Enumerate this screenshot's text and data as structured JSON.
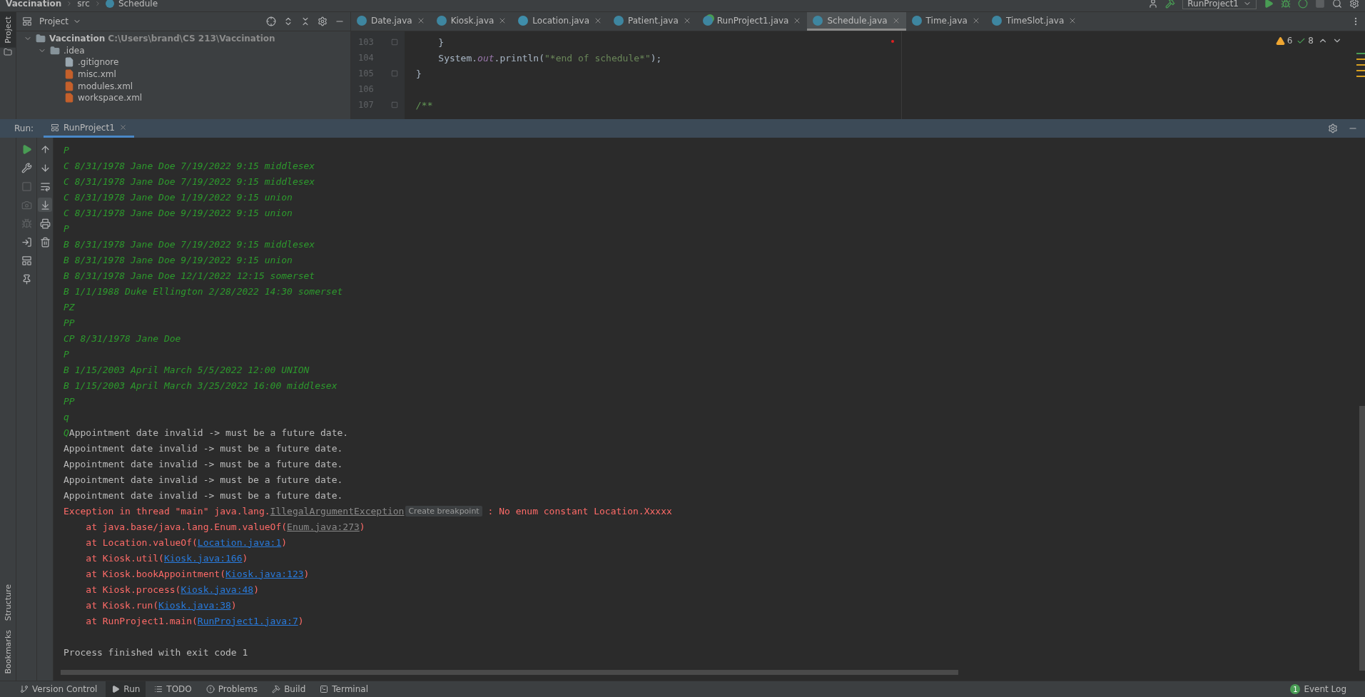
{
  "breadcrumb": [
    {
      "text": "Vaccination",
      "bold": true
    },
    {
      "text": "src",
      "bold": false
    },
    {
      "text": "Schedule",
      "bold": false
    }
  ],
  "run_config": {
    "label": "RunProject1"
  },
  "project_panel": {
    "title": "Project",
    "tree": [
      {
        "name": "Vaccination",
        "path": "C:\\Users\\brand\\CS 213\\Vaccination",
        "kind": "module",
        "expanded": true,
        "children": [
          {
            "name": ".idea",
            "kind": "folder",
            "expanded": true,
            "children": [
              {
                "name": ".gitignore",
                "kind": "ignore"
              },
              {
                "name": "misc.xml",
                "kind": "xml"
              },
              {
                "name": "modules.xml",
                "kind": "xml"
              },
              {
                "name": "workspace.xml",
                "kind": "xml"
              }
            ]
          }
        ]
      }
    ]
  },
  "editor_tabs": [
    {
      "label": "Date.java",
      "kind": "class",
      "selected": false
    },
    {
      "label": "Kiosk.java",
      "kind": "class",
      "selected": false
    },
    {
      "label": "Location.java",
      "kind": "enum",
      "selected": false
    },
    {
      "label": "Patient.java",
      "kind": "class",
      "selected": false
    },
    {
      "label": "RunProject1.java",
      "kind": "runnable",
      "selected": false
    },
    {
      "label": "Schedule.java",
      "kind": "class",
      "selected": true
    },
    {
      "label": "Time.java",
      "kind": "class",
      "selected": false
    },
    {
      "label": "TimeSlot.java",
      "kind": "class",
      "selected": false
    }
  ],
  "code_lines": [
    {
      "number": "103",
      "fold": true,
      "parts": [
        {
          "kind": "plain",
          "text": "    }"
        }
      ]
    },
    {
      "number": "104",
      "fold": false,
      "parts": [
        {
          "kind": "plain",
          "text": "    System."
        },
        {
          "kind": "field",
          "text": "out"
        },
        {
          "kind": "plain",
          "text": ".println("
        },
        {
          "kind": "string",
          "text": "\"*end of schedule*\""
        },
        {
          "kind": "plain",
          "text": ");"
        }
      ]
    },
    {
      "number": "105",
      "fold": true,
      "parts": [
        {
          "kind": "plain",
          "text": "}"
        }
      ]
    },
    {
      "number": "106",
      "fold": false
    },
    {
      "number": "107",
      "fold": true,
      "parts": [
        {
          "kind": "comment",
          "text": "/**"
        }
      ]
    }
  ],
  "inspections": {
    "warnings": "6",
    "typos": "8"
  },
  "run_panel": {
    "label": "Run:",
    "tab": "RunProject1"
  },
  "left_tools": [
    {
      "disabled": false
    },
    {
      "disabled": false
    },
    {
      "disabled": true
    },
    {
      "disabled": true
    },
    {
      "disabled": true
    },
    {
      "disabled": false
    },
    {
      "disabled": false
    },
    {
      "disabled": false
    }
  ],
  "right_tools": [
    {
      "selected": false
    },
    {
      "selected": false
    },
    {
      "selected": false
    },
    {
      "selected": true
    },
    {
      "selected": false
    },
    {
      "selected": false
    }
  ],
  "console": [
    [
      {
        "kind": "input",
        "text": "P"
      }
    ],
    [
      {
        "kind": "input",
        "text": "C 8/31/1978 Jane Doe 7/19/2022 9:15 middlesex"
      }
    ],
    [
      {
        "kind": "input",
        "text": "C 8/31/1978 Jane Doe 7/19/2022 9:15 middlesex"
      }
    ],
    [
      {
        "kind": "input",
        "text": "C 8/31/1978 Jane Doe 1/19/2022 9:15 union"
      }
    ],
    [
      {
        "kind": "input",
        "text": "C 8/31/1978 Jane Doe 9/19/2022 9:15 union"
      }
    ],
    [
      {
        "kind": "input",
        "text": "P"
      }
    ],
    [
      {
        "kind": "input",
        "text": "B 8/31/1978 Jane Doe 7/19/2022 9:15 middlesex"
      }
    ],
    [
      {
        "kind": "input",
        "text": "B 8/31/1978 Jane Doe 9/19/2022 9:15 union"
      }
    ],
    [
      {
        "kind": "input",
        "text": "B 8/31/1978 Jane Doe 12/1/2022 12:15 somerset"
      }
    ],
    [
      {
        "kind": "input",
        "text": "B 1/1/1988 Duke Ellington 2/28/2022 14:30 somerset"
      }
    ],
    [
      {
        "kind": "input",
        "text": "PZ"
      }
    ],
    [
      {
        "kind": "input",
        "text": "PP"
      }
    ],
    [
      {
        "kind": "input",
        "text": "CP 8/31/1978 Jane Doe"
      }
    ],
    [
      {
        "kind": "input",
        "text": "P"
      }
    ],
    [
      {
        "kind": "input",
        "text": "B 1/15/2003 April March 5/5/2022 12:00 UNION"
      }
    ],
    [
      {
        "kind": "input",
        "text": "B 1/15/2003 April March 3/25/2022 16:00 middlesex"
      }
    ],
    [
      {
        "kind": "input",
        "text": "PP"
      }
    ],
    [
      {
        "kind": "input",
        "text": "q"
      }
    ],
    [
      {
        "kind": "input",
        "text": "Q"
      },
      {
        "kind": "output",
        "text": "Appointment date invalid -> must be a future date."
      }
    ],
    [
      {
        "kind": "output",
        "text": "Appointment date invalid -> must be a future date."
      }
    ],
    [
      {
        "kind": "output",
        "text": "Appointment date invalid -> must be a future date."
      }
    ],
    [
      {
        "kind": "output",
        "text": "Appointment date invalid -> must be a future date."
      }
    ],
    [
      {
        "kind": "output",
        "text": "Appointment date invalid -> must be a future date."
      }
    ],
    [
      {
        "kind": "error",
        "text": "Exception in thread \"main\" java.lang."
      },
      {
        "kind": "muted-link",
        "text": "IllegalArgumentException"
      },
      {
        "kind": "hint",
        "text": "Create breakpoint"
      },
      {
        "kind": "error",
        "text": " : No enum constant Location.Xxxxx"
      }
    ],
    [
      {
        "kind": "error",
        "text": "    at java.base/java.lang.Enum.valueOf("
      },
      {
        "kind": "muted-link",
        "text": "Enum.java:273"
      },
      {
        "kind": "error",
        "text": ")"
      }
    ],
    [
      {
        "kind": "error",
        "text": "    at Location.valueOf("
      },
      {
        "kind": "link",
        "text": "Location.java:1"
      },
      {
        "kind": "error",
        "text": ")"
      }
    ],
    [
      {
        "kind": "error",
        "text": "    at Kiosk.util("
      },
      {
        "kind": "link",
        "text": "Kiosk.java:166"
      },
      {
        "kind": "error",
        "text": ")"
      }
    ],
    [
      {
        "kind": "error",
        "text": "    at Kiosk.bookAppointment("
      },
      {
        "kind": "link",
        "text": "Kiosk.java:123"
      },
      {
        "kind": "error",
        "text": ")"
      }
    ],
    [
      {
        "kind": "error",
        "text": "    at Kiosk.process("
      },
      {
        "kind": "link",
        "text": "Kiosk.java:48"
      },
      {
        "kind": "error",
        "text": ")"
      }
    ],
    [
      {
        "kind": "error",
        "text": "    at Kiosk.run("
      },
      {
        "kind": "link",
        "text": "Kiosk.java:38"
      },
      {
        "kind": "error",
        "text": ")"
      }
    ],
    [
      {
        "kind": "error",
        "text": "    at RunProject1.main("
      },
      {
        "kind": "link",
        "text": "RunProject1.java:7"
      },
      {
        "kind": "error",
        "text": ")"
      }
    ],
    [
      {
        "kind": "summary",
        "text": "Process finished with exit code 1"
      }
    ]
  ],
  "side_tabs": {
    "top": "Project",
    "bottom": [
      "Structure",
      "Bookmarks"
    ]
  },
  "status_bar": {
    "tools": [
      {
        "label": "Version Control",
        "selected": false
      },
      {
        "label": "Run",
        "selected": true
      },
      {
        "label": "TODO",
        "selected": false
      },
      {
        "label": "Problems",
        "selected": false
      },
      {
        "label": "Build",
        "selected": false
      },
      {
        "label": "Terminal",
        "selected": false
      }
    ],
    "event_log": {
      "label": "Event Log",
      "count": "1"
    }
  }
}
